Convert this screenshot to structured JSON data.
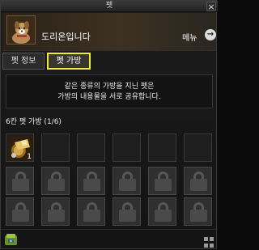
{
  "window": {
    "title": "펫",
    "close_symbol": "×"
  },
  "header": {
    "pet_name": "도리온입니다",
    "menu_label": "메뉴",
    "menu_symbol": "→"
  },
  "tabs": [
    {
      "label": "펫 정보",
      "selected": false
    },
    {
      "label": "펫 가방",
      "selected": true
    }
  ],
  "info": {
    "line1": "같은 종류의 가방을 지닌 펫은",
    "line2": "가방의 내용물을 서로 공유합니다."
  },
  "bag": {
    "title": "6칸 펫 가방 (1/6)",
    "item": {
      "icon": "equipment-item-icon",
      "count": "1"
    }
  },
  "colors": {
    "selected_tab_border": "#f1ea3a"
  }
}
